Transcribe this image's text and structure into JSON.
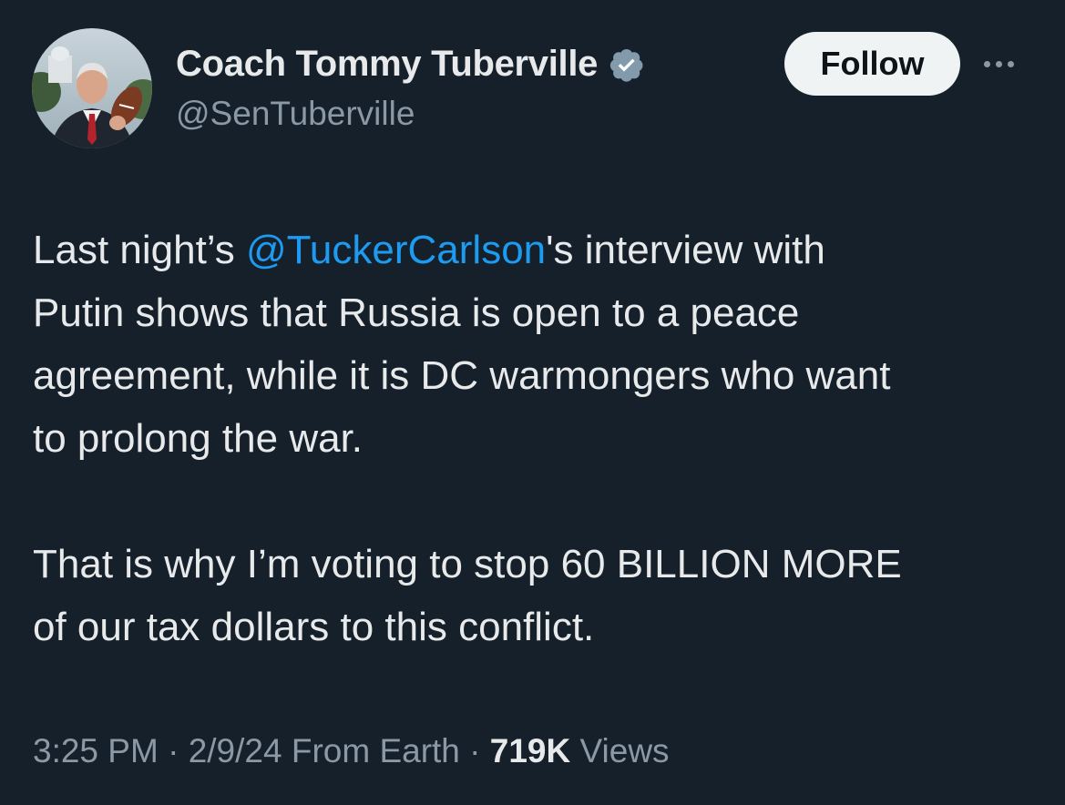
{
  "author": {
    "display_name": "Coach Tommy Tuberville",
    "handle": "@SenTuberville",
    "verified_icon": "verified-badge-icon"
  },
  "actions": {
    "follow_label": "Follow",
    "more_icon": "more-options-icon"
  },
  "tweet": {
    "para1_prefix": "Last night’s ",
    "mention": "@TuckerCarlson",
    "para1_line1_suffix": "'s interview with",
    "para1_line2": "Putin shows that Russia is open to a peace",
    "para1_line3": "agreement, while it is DC warmongers who want",
    "para1_line4": "to prolong the war.",
    "para2_line1": "That is why I’m voting to stop 60 BILLION MORE",
    "para2_line2": "of our tax dollars to this conflict."
  },
  "meta": {
    "time": "3:25 PM",
    "date": "2/9/24",
    "source": "From Earth",
    "separator": "·",
    "views_count": "719K",
    "views_label": "Views"
  },
  "colors": {
    "background": "#15202b",
    "text": "#e7e9ea",
    "secondary": "#8b98a5",
    "link": "#1d9bf0",
    "badge": "#829aab"
  }
}
